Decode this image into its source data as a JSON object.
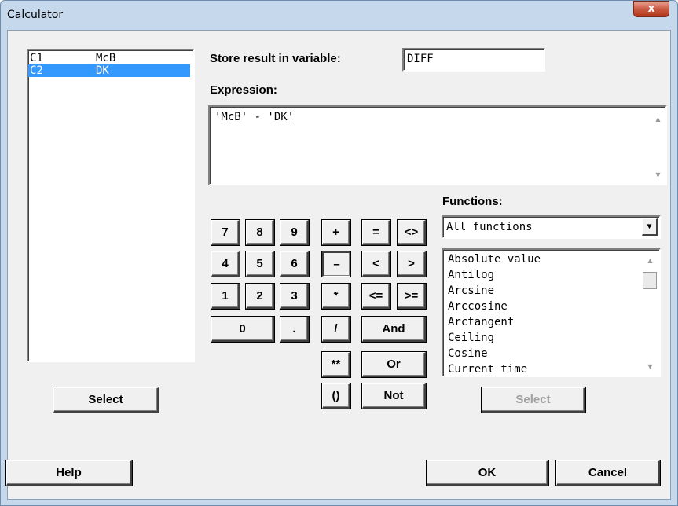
{
  "window": {
    "title": "Calculator",
    "close_label": "x"
  },
  "variables": [
    {
      "col": "C1",
      "name": "McB",
      "selected": false
    },
    {
      "col": "C2",
      "name": "DK",
      "selected": true
    }
  ],
  "left_select_label": "Select",
  "store": {
    "label": "Store result in variable:",
    "value": "DIFF"
  },
  "expression": {
    "label": "Expression:",
    "value": "'McB' - 'DK'"
  },
  "keypad": {
    "digits": [
      "7",
      "8",
      "9",
      "4",
      "5",
      "6",
      "1",
      "2",
      "3",
      "0",
      "."
    ],
    "operators": [
      "+",
      "–",
      "*",
      "/",
      "**",
      "()"
    ],
    "comparisons": [
      "=",
      "<>",
      "<",
      ">",
      "<=",
      ">="
    ],
    "logical": [
      "And",
      "Or",
      "Not"
    ]
  },
  "functions": {
    "label": "Functions:",
    "dropdown_value": "All functions",
    "items": [
      "Absolute value",
      "Antilog",
      "Arcsine",
      "Arccosine",
      "Arctangent",
      "Ceiling",
      "Cosine",
      "Current time"
    ],
    "select_label": "Select"
  },
  "buttons": {
    "help": "Help",
    "ok": "OK",
    "cancel": "Cancel"
  }
}
